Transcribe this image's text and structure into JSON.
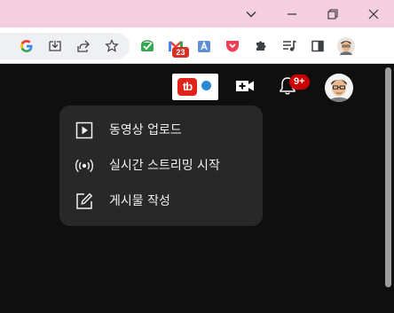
{
  "browser": {
    "window_controls": {
      "dropdown_icon": "chevron-down-icon",
      "minimize_icon": "minimize-icon",
      "restore_icon": "restore-icon",
      "close_icon": "close-icon"
    },
    "toolbar": {
      "icons": [
        "google-icon",
        "install-app-icon",
        "share-icon",
        "bookmark-star-icon",
        "extension-green-icon",
        "gmail-icon",
        "appstore-icon",
        "pocket-icon",
        "extensions-puzzle-icon",
        "media-queue-icon",
        "side-panel-icon",
        "profile-avatar-icon"
      ],
      "gmail_badge": "23"
    }
  },
  "youtube_header": {
    "extension_logo_text": "tb",
    "create_icon": "video-camera-plus-icon",
    "notifications_icon": "bell-icon",
    "notifications_count": "9+",
    "avatar_icon": "user-avatar-icon"
  },
  "create_menu": {
    "items": [
      {
        "label": "동영상 업로드",
        "icon": "upload-video-icon"
      },
      {
        "label": "실시간 스트리밍 시작",
        "icon": "live-stream-icon"
      },
      {
        "label": "게시물 작성",
        "icon": "create-post-icon"
      }
    ]
  },
  "colors": {
    "titlebar": "#f5cfe0",
    "page_background": "#0f0f0f",
    "menu_background": "#282828",
    "menu_text": "#f1f1f1",
    "notification_badge": "#cc0000",
    "extension_red": "#e2231a",
    "extension_blue_dot": "#2a8ad6"
  }
}
